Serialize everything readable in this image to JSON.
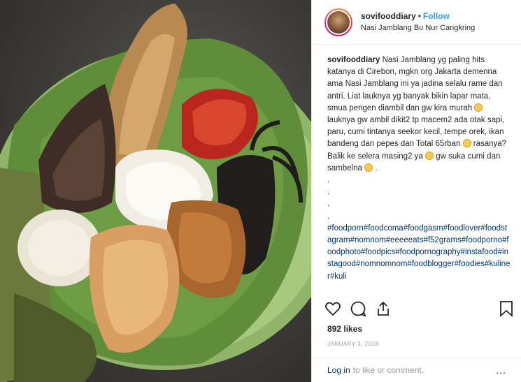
{
  "post": {
    "username": "sovifooddiary",
    "follow_label": "Follow",
    "location": "Nasi Jamblang Bu Nur Cangkring",
    "caption": {
      "text_1": "Nasi Jamblang yg paling hits katanya di Cirebon, mgkn org Jakarta demenna ama Nasi Jamblang ini ya jadina selalu rame dan antri. Liat lauknya yg banyak bikin lapar mata, smua pengen diambil dan gw kira murah",
      "text_2": " lauknya gw ambil dikit2 tp macem2 ada otak sapi, paru, cumi tintanya seekor kecil, tempe orek, ikan bandeng dan pepes dan Total 65rban",
      "text_3": " rasanya? Balik ke selera masing2 ya",
      "text_4": " gw suka cumi dan sambelna",
      "text_5": " .",
      "dots": [
        ".",
        ".",
        ".",
        "."
      ],
      "hashtags": "#foodporn#foodcoma#foodgasm#foodlover#foodstagram#nomnom#eeeeeats#f52grams#foodporno#foodphoto#foodpics#foodpornography#instafood#instagood#nomnomnom#foodblogger#foodies#kuliner#kuli"
    },
    "likes": "892 likes",
    "date": "JANUARY 3, 2018",
    "comment": {
      "login_label": "Log in",
      "rest_label": "to like or comment.",
      "more_label": "..."
    }
  },
  "icons": [
    "heart-icon",
    "comment-icon",
    "share-icon",
    "bookmark-icon",
    "emoji-icon"
  ],
  "colors": {
    "link": "#3897f0",
    "hashtag": "#003569",
    "muted": "#999999"
  }
}
